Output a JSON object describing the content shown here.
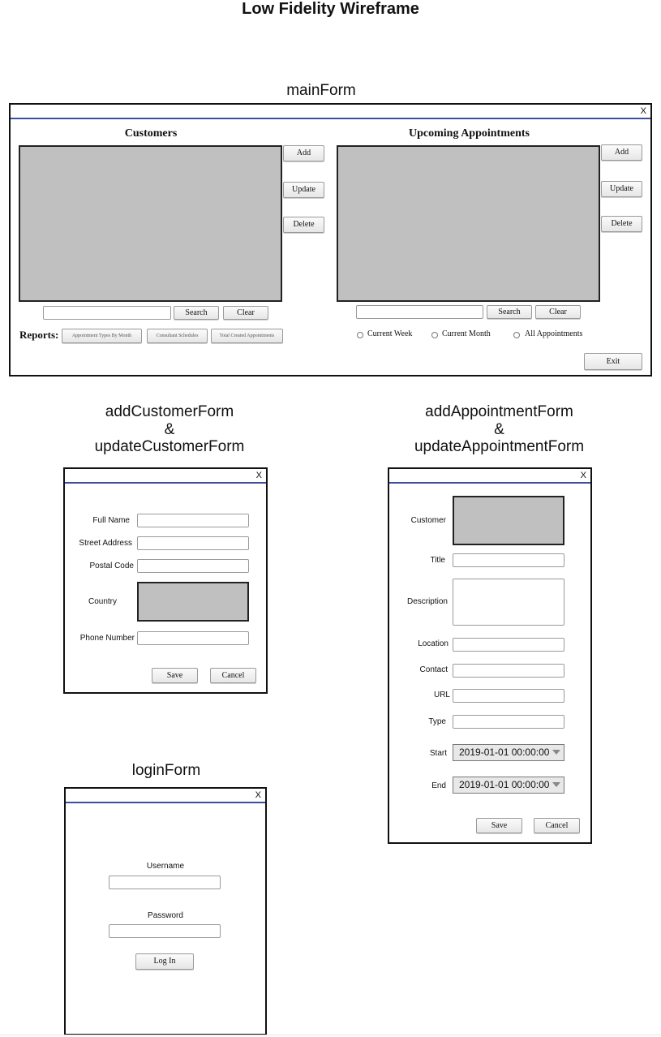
{
  "title": "Low Fidelity Wireframe",
  "close_glyph": "X",
  "main_form": {
    "caption": "mainForm",
    "customers": {
      "heading": "Customers",
      "add": "Add",
      "update": "Update",
      "delete": "Delete",
      "search": "Search",
      "clear": "Clear"
    },
    "appointments": {
      "heading": "Upcoming Appointments",
      "add": "Add",
      "update": "Update",
      "delete": "Delete",
      "search": "Search",
      "clear": "Clear"
    },
    "reports": {
      "label": "Reports:",
      "buttons": [
        "Appointment Types By Month",
        "Consultant Schedules",
        "Total Created Appointments"
      ]
    },
    "filters": [
      "Current Week",
      "Current Month",
      "All Appointments"
    ],
    "exit": "Exit"
  },
  "customer_form": {
    "caption_lines": [
      "addCustomerForm",
      "&",
      "updateCustomerForm"
    ],
    "labels": {
      "full_name": "Full Name",
      "street_address": "Street Address",
      "postal_code": "Postal Code",
      "country": "Country",
      "phone_number": "Phone Number"
    },
    "save": "Save",
    "cancel": "Cancel"
  },
  "appointment_form": {
    "caption_lines": [
      "addAppointmentForm",
      "&",
      "updateAppointmentForm"
    ],
    "labels": {
      "customer": "Customer",
      "title": "Title",
      "description": "Description",
      "location": "Location",
      "contact": "Contact",
      "url": "URL",
      "type": "Type",
      "start": "Start",
      "end": "End"
    },
    "start_value": "2019-01-01 00:00:00",
    "end_value": "2019-01-01 00:00:00",
    "save": "Save",
    "cancel": "Cancel"
  },
  "login_form": {
    "caption": "loginForm",
    "username_label": "Username",
    "password_label": "Password",
    "login": "Log In"
  }
}
